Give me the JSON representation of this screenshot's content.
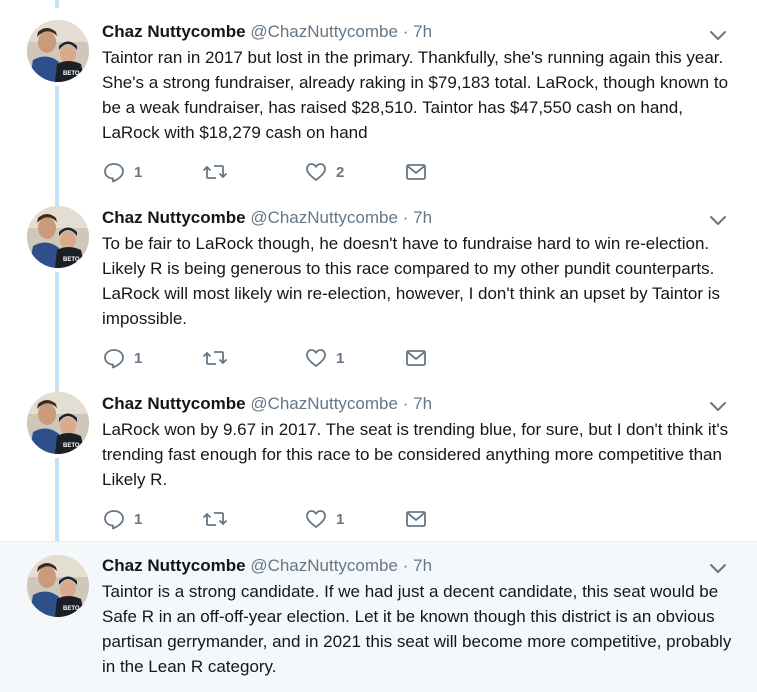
{
  "tweets": [
    {
      "name": "Chaz Nuttycombe",
      "handle": "@ChazNuttycombe",
      "dot": "·",
      "time": "7h",
      "text": "Taintor ran in 2017 but lost in the primary. Thankfully, she's running again this year. She's a strong fundraiser, already raking in $79,183 total. LaRock, though known to be a weak fundraiser, has raised $28,510. Taintor has $47,550 cash on hand, LaRock with $18,279 cash on hand",
      "replies": "1",
      "likes": "2"
    },
    {
      "name": "Chaz Nuttycombe",
      "handle": "@ChazNuttycombe",
      "dot": "·",
      "time": "7h",
      "text": "To be fair to LaRock though, he doesn't have to fundraise hard to win re-election. Likely R is being generous to this race compared to my other pundit counterparts. LaRock will most likely win re-election, however, I don't think an upset by Taintor is impossible.",
      "replies": "1",
      "likes": "1"
    },
    {
      "name": "Chaz Nuttycombe",
      "handle": "@ChazNuttycombe",
      "dot": "·",
      "time": "7h",
      "text": "LaRock won by 9.67 in 2017. The seat is trending blue, for sure, but I don't think it's trending fast enough for this race to be considered anything more competitive than Likely R.",
      "replies": "1",
      "likes": "1"
    },
    {
      "name": "Chaz Nuttycombe",
      "handle": "@ChazNuttycombe",
      "dot": "·",
      "time": "7h",
      "text": "Taintor is a strong candidate. If we had just a decent candidate, this seat would be Safe R in an off-off-year election. Let it be known though this district is an obvious partisan gerrymander, and in 2021 this seat will become more competitive, probably in the Lean R category."
    }
  ],
  "colors": {
    "thread_line": "#c4e1f6",
    "icon_gray": "#657786",
    "highlight_bg": "#f5f8fa"
  }
}
